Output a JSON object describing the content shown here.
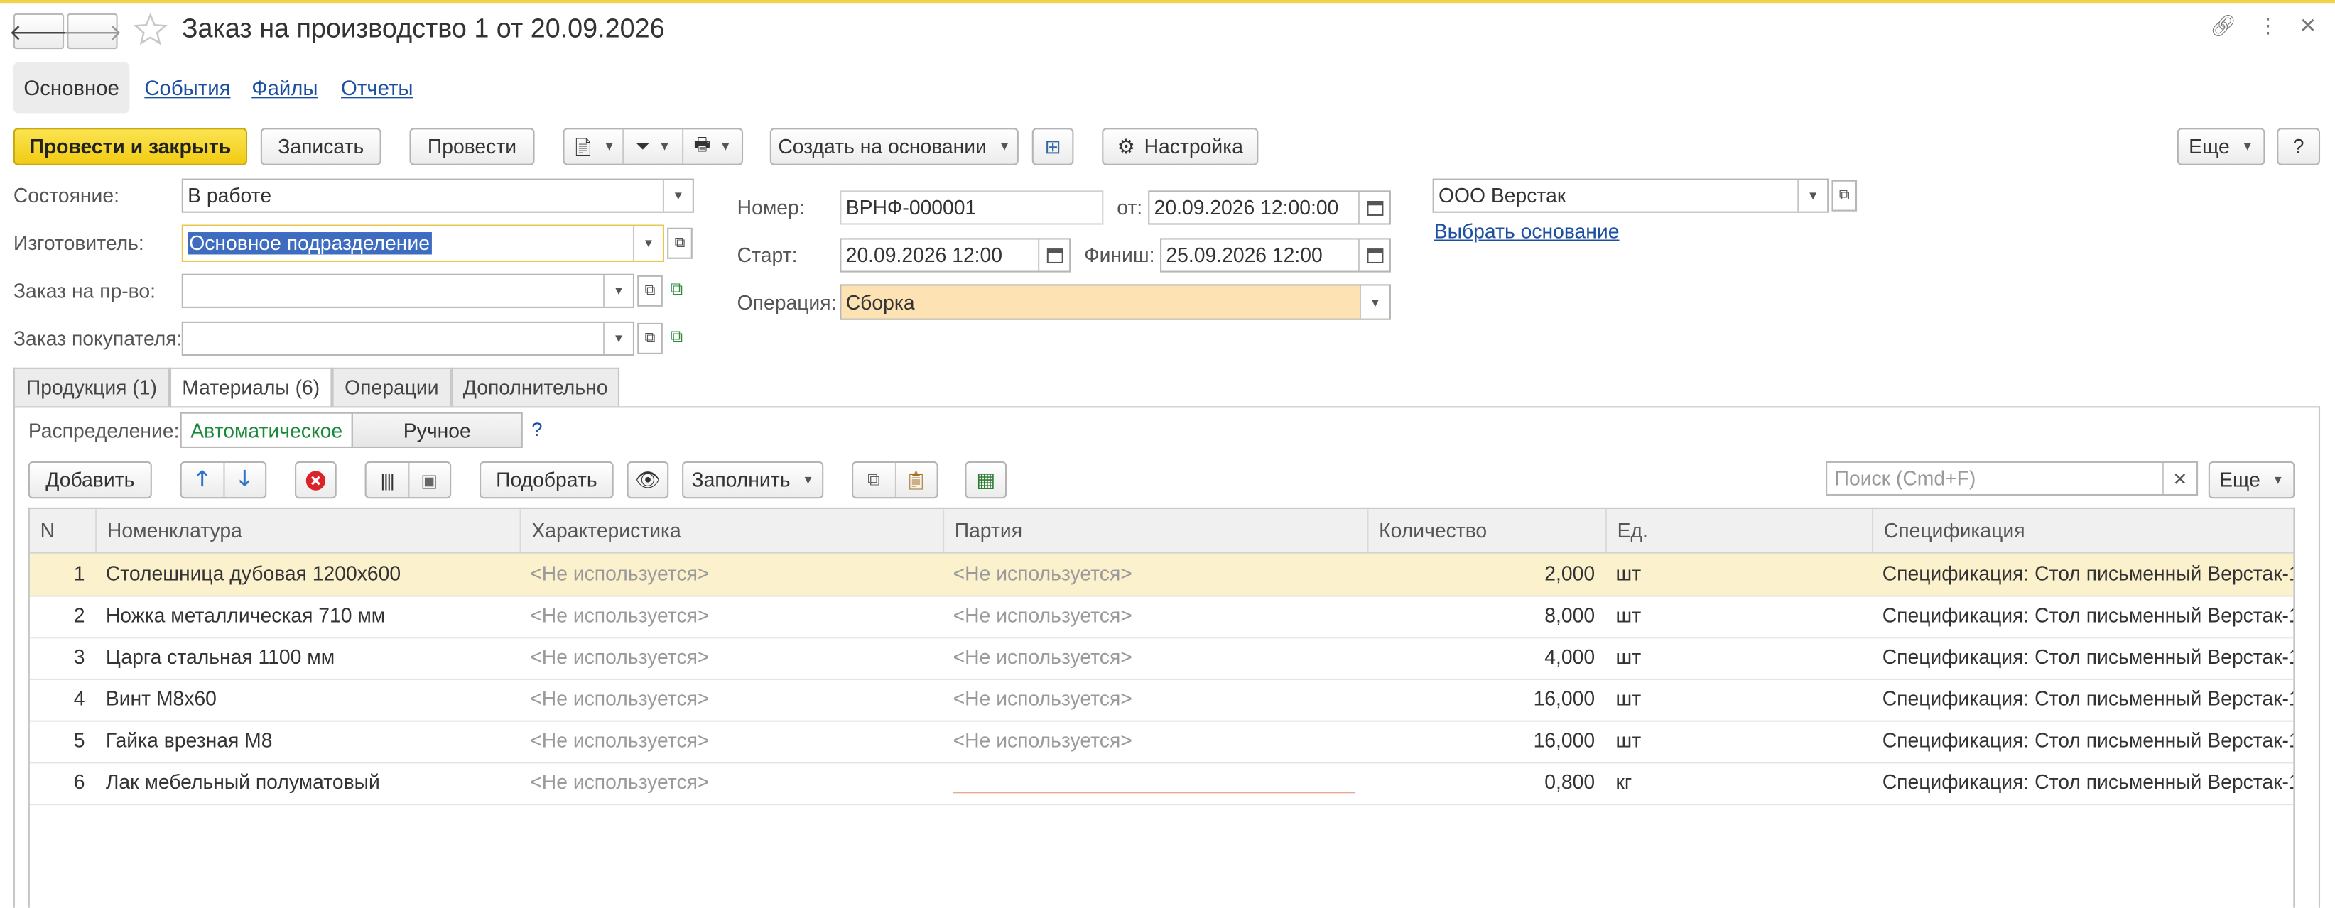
{
  "window": {
    "title": "Заказ на производство 1 от 20.09.2026",
    "nav_tabs": [
      "Основное",
      "События",
      "Файлы",
      "Отчеты"
    ]
  },
  "toolbar": {
    "post_close": "Провести и закрыть",
    "save": "Записать",
    "post": "Провести",
    "create_based": "Создать на основании",
    "settings": "Настройка",
    "more": "Еще",
    "help": "?"
  },
  "form": {
    "state_label": "Состояние:",
    "state_value": "В работе",
    "maker_label": "Изготовитель:",
    "maker_value": "Основное подразделение",
    "prod_order_label": "Заказ на пр-во:",
    "prod_order_value": "",
    "customer_order_label": "Заказ покупателя:",
    "customer_order_value": "",
    "number_label": "Номер:",
    "number_value": "ВРНФ-000001",
    "date_label": "от:",
    "date_value": "20.09.2026 12:00:00",
    "start_label": "Старт:",
    "start_value": "20.09.2026 12:00",
    "finish_label": "Финиш:",
    "finish_value": "25.09.2026 12:00",
    "operation_label": "Операция:",
    "operation_value": "Сборка",
    "org_value": "ООО Верстак",
    "choose_basis": "Выбрать основание"
  },
  "tabs": [
    "Продукция (1)",
    "Материалы (6)",
    "Операции",
    "Дополнительно"
  ],
  "materials": {
    "distribution_label": "Распределение:",
    "auto": "Автоматическое",
    "manual": "Ручное",
    "help": "?",
    "add": "Добавить",
    "pick": "Подобрать",
    "fill": "Заполнить",
    "search_placeholder": "Поиск (Cmd+F)",
    "more": "Еще",
    "columns": [
      "N",
      "Номенклатура",
      "Характеристика",
      "Партия",
      "Количество",
      "Ед.",
      "Спецификация"
    ],
    "rows": [
      {
        "n": "1",
        "name": "Столешница дубовая 1200х600",
        "char": "<Не используется>",
        "batch": "<Не используется>",
        "qty": "2,000",
        "unit": "шт",
        "spec": "Спецификация: Стол письменный Верстак-1"
      },
      {
        "n": "2",
        "name": "Ножка металлическая 710 мм",
        "char": "<Не используется>",
        "batch": "<Не используется>",
        "qty": "8,000",
        "unit": "шт",
        "spec": "Спецификация: Стол письменный Верстак-1"
      },
      {
        "n": "3",
        "name": "Царга стальная 1100 мм",
        "char": "<Не используется>",
        "batch": "<Не используется>",
        "qty": "4,000",
        "unit": "шт",
        "spec": "Спецификация: Стол письменный Верстак-1"
      },
      {
        "n": "4",
        "name": "Винт М8х60",
        "char": "<Не используется>",
        "batch": "<Не используется>",
        "qty": "16,000",
        "unit": "шт",
        "spec": "Спецификация: Стол письменный Верстак-1"
      },
      {
        "n": "5",
        "name": "Гайка врезная М8",
        "char": "<Не используется>",
        "batch": "<Не используется>",
        "qty": "16,000",
        "unit": "шт",
        "spec": "Спецификация: Стол письменный Верстак-1"
      },
      {
        "n": "6",
        "name": "Лак мебельный полуматовый",
        "char": "<Не используется>",
        "batch": "",
        "qty": "0,800",
        "unit": "кг",
        "spec": "Спецификация: Стол письменный Верстак-1"
      }
    ]
  }
}
